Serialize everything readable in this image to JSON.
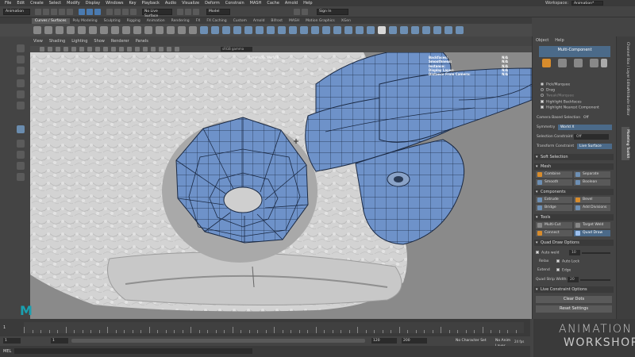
{
  "menubar": {
    "items": [
      "File",
      "Edit",
      "Create",
      "Select",
      "Modify",
      "Display",
      "Windows",
      "Key",
      "Playback",
      "Audio",
      "Visualize",
      "Deform",
      "Constrain",
      "MASH",
      "Cache",
      "Arnold",
      "Help"
    ],
    "workspace_label": "Workspace:",
    "workspace_value": "Animation*"
  },
  "statusline": {
    "menuset": "Animation",
    "live_field": "No Live Surface",
    "object_field": "Model",
    "sign_in": "Sign In"
  },
  "shelf_tabs": {
    "items": [
      "Curves / Surfaces",
      "Poly Modeling",
      "Sculpting",
      "Rigging",
      "Animation",
      "Rendering",
      "FX",
      "FX Caching",
      "Custom",
      "Arnold",
      "Bifrost",
      "MASH",
      "Motion Graphics",
      "XGen"
    ],
    "active_index": 0
  },
  "viewport_menu": {
    "items": [
      "View",
      "Shading",
      "Lighting",
      "Show",
      "Renderer",
      "Panels"
    ],
    "camera_field": "sRGB gamma"
  },
  "hud": {
    "rows": [
      {
        "label": "Backfaces:",
        "value": "N/A"
      },
      {
        "label": "Smoothness:",
        "value": "N/A"
      },
      {
        "label": "Instance:",
        "value": "N/A"
      },
      {
        "label": "Display Layer:",
        "value": "N/A"
      },
      {
        "label": "Distance From Camera:",
        "value": "N/A"
      }
    ],
    "persp": "Symmetry: World X"
  },
  "right_panel": {
    "menu": [
      "Object",
      "Help"
    ],
    "header": "Multi-Component",
    "pick_marquee": "Pick/Marquee",
    "drag": "Drag",
    "tweak_marquee": "Tweak/Marquee",
    "highlight_backfaces": "Highlight Backfaces",
    "highlight_nearest": "Highlight Nearest Component",
    "camera_based_label": "Camera Based Selection",
    "camera_based_value": "Off",
    "symmetry_label": "Symmetry",
    "symmetry_value": "World X",
    "selection_constraint_label": "Selection Constraint",
    "selection_constraint_value": "Off",
    "transform_constraint_label": "Transform Constraint",
    "transform_constraint_value": "Live Surface",
    "soft_selection": "Soft Selection",
    "mesh_section": "Mesh",
    "combine": "Combine",
    "separate": "Separate",
    "smooth": "Smooth",
    "boolean": "Boolean",
    "components_section": "Components",
    "extrude": "Extrude",
    "bevel": "Bevel",
    "bridge": "Bridge",
    "add_divisions": "Add Divisions",
    "tools_section": "Tools",
    "multi_cut": "Multi-Cut",
    "target_weld": "Target Weld",
    "connect": "Connect",
    "quad_draw": "Quad Draw",
    "quad_draw_options": "Quad Draw Options",
    "auto_weld": "Auto weld",
    "auto_weld_value": "10",
    "relax_label": "Relax",
    "auto_lock": "Auto Lock",
    "extend_label": "Extend",
    "edge": "Edge",
    "quad_strip_label": "Quad Strip Width:",
    "quad_strip_value": "20",
    "live_constraint_options": "Live Constraint Options",
    "clear_dots": "Clear Dots",
    "reset_settings": "Reset Settings"
  },
  "side_tabs": [
    "Channel Box / Layer Editor",
    "Attribute Editor",
    "Modeling Toolkit"
  ],
  "timeline": {
    "current": "1",
    "start": "1",
    "start_inner": "1",
    "end_inner": "120",
    "end": "120",
    "max": "200",
    "character_set": "No Character Set",
    "anim_layer": "No Anim Layer",
    "fps": "24 fps"
  },
  "command_line": {
    "label": "MEL"
  },
  "logo": "M",
  "watermark": {
    "line1": "ANIMATION",
    "line2": "WORKSHOP"
  },
  "colors": {
    "accent": "#4b6a89",
    "mesh_blue": "#6b90c8",
    "sculpt_gray": "#d0d0d0"
  }
}
